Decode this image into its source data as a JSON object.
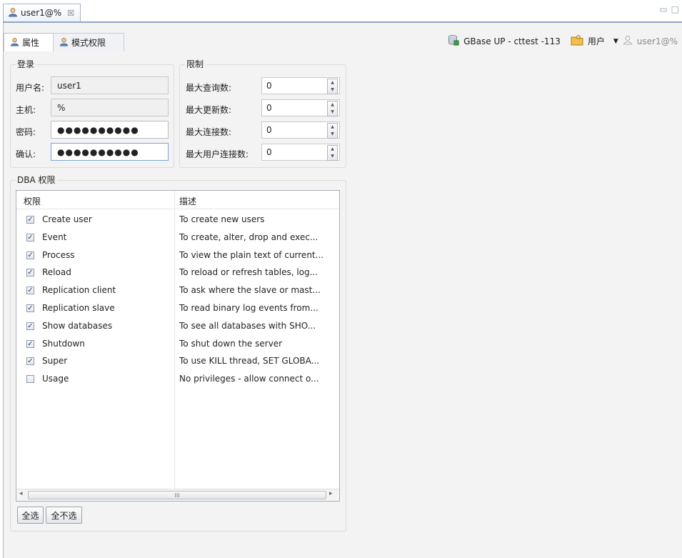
{
  "editor_tab": {
    "title": "user1@%",
    "close": "☒"
  },
  "window_controls": {
    "minimize": "▭",
    "maximize": "□"
  },
  "subtabs": [
    {
      "label": "属性"
    },
    {
      "label": "模式权限"
    }
  ],
  "toolbar": {
    "connection": "GBase UP - cttest -113",
    "users_label": "用户",
    "current_user": "user1@%"
  },
  "login": {
    "title": "登录",
    "username_label": "用户名:",
    "username": "user1",
    "host_label": "主机:",
    "host": "%",
    "password_label": "密码:",
    "password": "●●●●●●●●●●",
    "confirm_label": "确认:",
    "confirm": "●●●●●●●●●●"
  },
  "limits": {
    "title": "限制",
    "items": [
      {
        "label": "最大查询数:",
        "value": "0"
      },
      {
        "label": "最大更新数:",
        "value": "0"
      },
      {
        "label": "最大连接数:",
        "value": "0"
      },
      {
        "label": "最大用户连接数:",
        "value": "0"
      }
    ]
  },
  "dba": {
    "title": "DBA 权限",
    "col_privilege": "权限",
    "col_description": "描述",
    "rows": [
      {
        "name": "Create user",
        "desc": "To create new users",
        "checked": true
      },
      {
        "name": "Event",
        "desc": "To create, alter, drop and exec...",
        "checked": true
      },
      {
        "name": "Process",
        "desc": "To view the plain text of current...",
        "checked": true
      },
      {
        "name": "Reload",
        "desc": "To reload or refresh tables, log...",
        "checked": true
      },
      {
        "name": "Replication client",
        "desc": "To ask where the slave or mast...",
        "checked": true
      },
      {
        "name": "Replication slave",
        "desc": "To read binary log events from...",
        "checked": true
      },
      {
        "name": "Show databases",
        "desc": "To see all databases with SHO...",
        "checked": true
      },
      {
        "name": "Shutdown",
        "desc": "To shut down the server",
        "checked": true
      },
      {
        "name": "Super",
        "desc": "To use KILL thread, SET GLOBA...",
        "checked": true
      },
      {
        "name": "Usage",
        "desc": "No privileges - allow connect o...",
        "checked": false
      }
    ],
    "scroll_grip": "III",
    "select_all": "全选",
    "select_none": "全不选"
  },
  "colors": {
    "accent": "#8fa6c7",
    "panel": "#f3f3f3",
    "border": "#a9aeb6"
  }
}
